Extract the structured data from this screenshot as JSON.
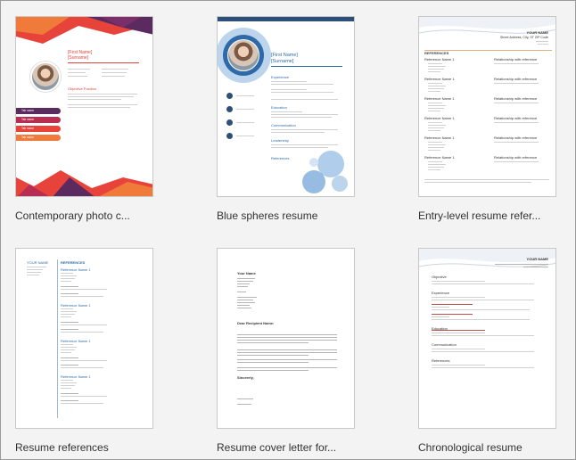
{
  "templates": [
    {
      "label": "Contemporary photo c...",
      "preview": {
        "first_name": "[First Name]",
        "surname": "[Surname]",
        "objective_heading": "Objective Position",
        "tabs": [
          "Tab name",
          "Tab name",
          "Tab name",
          "Tab name"
        ],
        "accent": "#e8433b"
      }
    },
    {
      "label": "Blue spheres resume",
      "preview": {
        "first_name": "[First Name]",
        "surname": "[Surname]",
        "sections": [
          "Experience",
          "Education",
          "Communication",
          "Leadership",
          "References"
        ],
        "accent": "#2e6aa8"
      }
    },
    {
      "label": "Entry-level resume refer...",
      "preview": {
        "name": "YOUR NAME",
        "address": "Street Address, City, ST ZIP Code",
        "heading": "REFERENCES",
        "ref_label": "Reference Name 1",
        "relationship": "Relationship with reference",
        "accent": "#2e6aa8"
      }
    },
    {
      "label": "Resume references",
      "preview": {
        "name": "YOUR NAME",
        "heading": "REFERENCES",
        "ref_label": "Reference Name 1",
        "accent": "#2e6aa8"
      }
    },
    {
      "label": "Resume cover letter for...",
      "preview": {
        "name": "Your Name",
        "recipient": "Dear Recipient Name:",
        "closing": "Sincerely,"
      }
    },
    {
      "label": "Chronological resume",
      "preview": {
        "name": "YOUR NAME",
        "sections": [
          "Objective",
          "Experience",
          "Education",
          "Communication",
          "References"
        ],
        "accent": "#c0504d"
      }
    }
  ]
}
